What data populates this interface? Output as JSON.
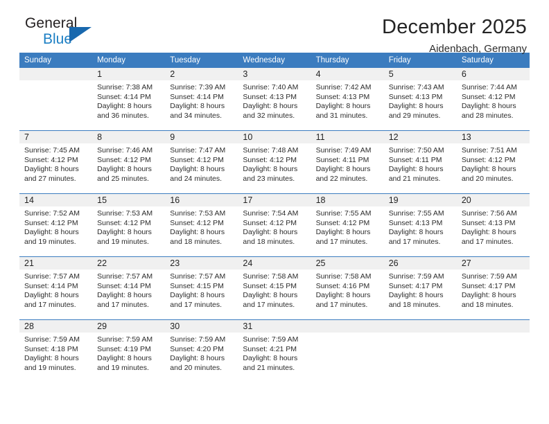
{
  "brand": {
    "line1": "General",
    "line2": "Blue",
    "triangle_color": "#1868ae"
  },
  "header": {
    "title": "December 2025",
    "subtitle": "Aidenbach, Germany"
  },
  "theme": {
    "header_blue": "#3b7cbf",
    "daynum_band": "#f0f0f0",
    "text": "#2b2b2b"
  },
  "weekday_headers": [
    "Sunday",
    "Monday",
    "Tuesday",
    "Wednesday",
    "Thursday",
    "Friday",
    "Saturday"
  ],
  "weeks": [
    [
      {
        "day": "",
        "sunrise": "",
        "sunset": "",
        "daylight1": "",
        "daylight2": ""
      },
      {
        "day": "1",
        "sunrise": "Sunrise: 7:38 AM",
        "sunset": "Sunset: 4:14 PM",
        "daylight1": "Daylight: 8 hours",
        "daylight2": "and 36 minutes."
      },
      {
        "day": "2",
        "sunrise": "Sunrise: 7:39 AM",
        "sunset": "Sunset: 4:14 PM",
        "daylight1": "Daylight: 8 hours",
        "daylight2": "and 34 minutes."
      },
      {
        "day": "3",
        "sunrise": "Sunrise: 7:40 AM",
        "sunset": "Sunset: 4:13 PM",
        "daylight1": "Daylight: 8 hours",
        "daylight2": "and 32 minutes."
      },
      {
        "day": "4",
        "sunrise": "Sunrise: 7:42 AM",
        "sunset": "Sunset: 4:13 PM",
        "daylight1": "Daylight: 8 hours",
        "daylight2": "and 31 minutes."
      },
      {
        "day": "5",
        "sunrise": "Sunrise: 7:43 AM",
        "sunset": "Sunset: 4:13 PM",
        "daylight1": "Daylight: 8 hours",
        "daylight2": "and 29 minutes."
      },
      {
        "day": "6",
        "sunrise": "Sunrise: 7:44 AM",
        "sunset": "Sunset: 4:12 PM",
        "daylight1": "Daylight: 8 hours",
        "daylight2": "and 28 minutes."
      }
    ],
    [
      {
        "day": "7",
        "sunrise": "Sunrise: 7:45 AM",
        "sunset": "Sunset: 4:12 PM",
        "daylight1": "Daylight: 8 hours",
        "daylight2": "and 27 minutes."
      },
      {
        "day": "8",
        "sunrise": "Sunrise: 7:46 AM",
        "sunset": "Sunset: 4:12 PM",
        "daylight1": "Daylight: 8 hours",
        "daylight2": "and 25 minutes."
      },
      {
        "day": "9",
        "sunrise": "Sunrise: 7:47 AM",
        "sunset": "Sunset: 4:12 PM",
        "daylight1": "Daylight: 8 hours",
        "daylight2": "and 24 minutes."
      },
      {
        "day": "10",
        "sunrise": "Sunrise: 7:48 AM",
        "sunset": "Sunset: 4:12 PM",
        "daylight1": "Daylight: 8 hours",
        "daylight2": "and 23 minutes."
      },
      {
        "day": "11",
        "sunrise": "Sunrise: 7:49 AM",
        "sunset": "Sunset: 4:11 PM",
        "daylight1": "Daylight: 8 hours",
        "daylight2": "and 22 minutes."
      },
      {
        "day": "12",
        "sunrise": "Sunrise: 7:50 AM",
        "sunset": "Sunset: 4:11 PM",
        "daylight1": "Daylight: 8 hours",
        "daylight2": "and 21 minutes."
      },
      {
        "day": "13",
        "sunrise": "Sunrise: 7:51 AM",
        "sunset": "Sunset: 4:12 PM",
        "daylight1": "Daylight: 8 hours",
        "daylight2": "and 20 minutes."
      }
    ],
    [
      {
        "day": "14",
        "sunrise": "Sunrise: 7:52 AM",
        "sunset": "Sunset: 4:12 PM",
        "daylight1": "Daylight: 8 hours",
        "daylight2": "and 19 minutes."
      },
      {
        "day": "15",
        "sunrise": "Sunrise: 7:53 AM",
        "sunset": "Sunset: 4:12 PM",
        "daylight1": "Daylight: 8 hours",
        "daylight2": "and 19 minutes."
      },
      {
        "day": "16",
        "sunrise": "Sunrise: 7:53 AM",
        "sunset": "Sunset: 4:12 PM",
        "daylight1": "Daylight: 8 hours",
        "daylight2": "and 18 minutes."
      },
      {
        "day": "17",
        "sunrise": "Sunrise: 7:54 AM",
        "sunset": "Sunset: 4:12 PM",
        "daylight1": "Daylight: 8 hours",
        "daylight2": "and 18 minutes."
      },
      {
        "day": "18",
        "sunrise": "Sunrise: 7:55 AM",
        "sunset": "Sunset: 4:12 PM",
        "daylight1": "Daylight: 8 hours",
        "daylight2": "and 17 minutes."
      },
      {
        "day": "19",
        "sunrise": "Sunrise: 7:55 AM",
        "sunset": "Sunset: 4:13 PM",
        "daylight1": "Daylight: 8 hours",
        "daylight2": "and 17 minutes."
      },
      {
        "day": "20",
        "sunrise": "Sunrise: 7:56 AM",
        "sunset": "Sunset: 4:13 PM",
        "daylight1": "Daylight: 8 hours",
        "daylight2": "and 17 minutes."
      }
    ],
    [
      {
        "day": "21",
        "sunrise": "Sunrise: 7:57 AM",
        "sunset": "Sunset: 4:14 PM",
        "daylight1": "Daylight: 8 hours",
        "daylight2": "and 17 minutes."
      },
      {
        "day": "22",
        "sunrise": "Sunrise: 7:57 AM",
        "sunset": "Sunset: 4:14 PM",
        "daylight1": "Daylight: 8 hours",
        "daylight2": "and 17 minutes."
      },
      {
        "day": "23",
        "sunrise": "Sunrise: 7:57 AM",
        "sunset": "Sunset: 4:15 PM",
        "daylight1": "Daylight: 8 hours",
        "daylight2": "and 17 minutes."
      },
      {
        "day": "24",
        "sunrise": "Sunrise: 7:58 AM",
        "sunset": "Sunset: 4:15 PM",
        "daylight1": "Daylight: 8 hours",
        "daylight2": "and 17 minutes."
      },
      {
        "day": "25",
        "sunrise": "Sunrise: 7:58 AM",
        "sunset": "Sunset: 4:16 PM",
        "daylight1": "Daylight: 8 hours",
        "daylight2": "and 17 minutes."
      },
      {
        "day": "26",
        "sunrise": "Sunrise: 7:59 AM",
        "sunset": "Sunset: 4:17 PM",
        "daylight1": "Daylight: 8 hours",
        "daylight2": "and 18 minutes."
      },
      {
        "day": "27",
        "sunrise": "Sunrise: 7:59 AM",
        "sunset": "Sunset: 4:17 PM",
        "daylight1": "Daylight: 8 hours",
        "daylight2": "and 18 minutes."
      }
    ],
    [
      {
        "day": "28",
        "sunrise": "Sunrise: 7:59 AM",
        "sunset": "Sunset: 4:18 PM",
        "daylight1": "Daylight: 8 hours",
        "daylight2": "and 19 minutes."
      },
      {
        "day": "29",
        "sunrise": "Sunrise: 7:59 AM",
        "sunset": "Sunset: 4:19 PM",
        "daylight1": "Daylight: 8 hours",
        "daylight2": "and 19 minutes."
      },
      {
        "day": "30",
        "sunrise": "Sunrise: 7:59 AM",
        "sunset": "Sunset: 4:20 PM",
        "daylight1": "Daylight: 8 hours",
        "daylight2": "and 20 minutes."
      },
      {
        "day": "31",
        "sunrise": "Sunrise: 7:59 AM",
        "sunset": "Sunset: 4:21 PM",
        "daylight1": "Daylight: 8 hours",
        "daylight2": "and 21 minutes."
      },
      {
        "day": "",
        "sunrise": "",
        "sunset": "",
        "daylight1": "",
        "daylight2": ""
      },
      {
        "day": "",
        "sunrise": "",
        "sunset": "",
        "daylight1": "",
        "daylight2": ""
      },
      {
        "day": "",
        "sunrise": "",
        "sunset": "",
        "daylight1": "",
        "daylight2": ""
      }
    ]
  ]
}
